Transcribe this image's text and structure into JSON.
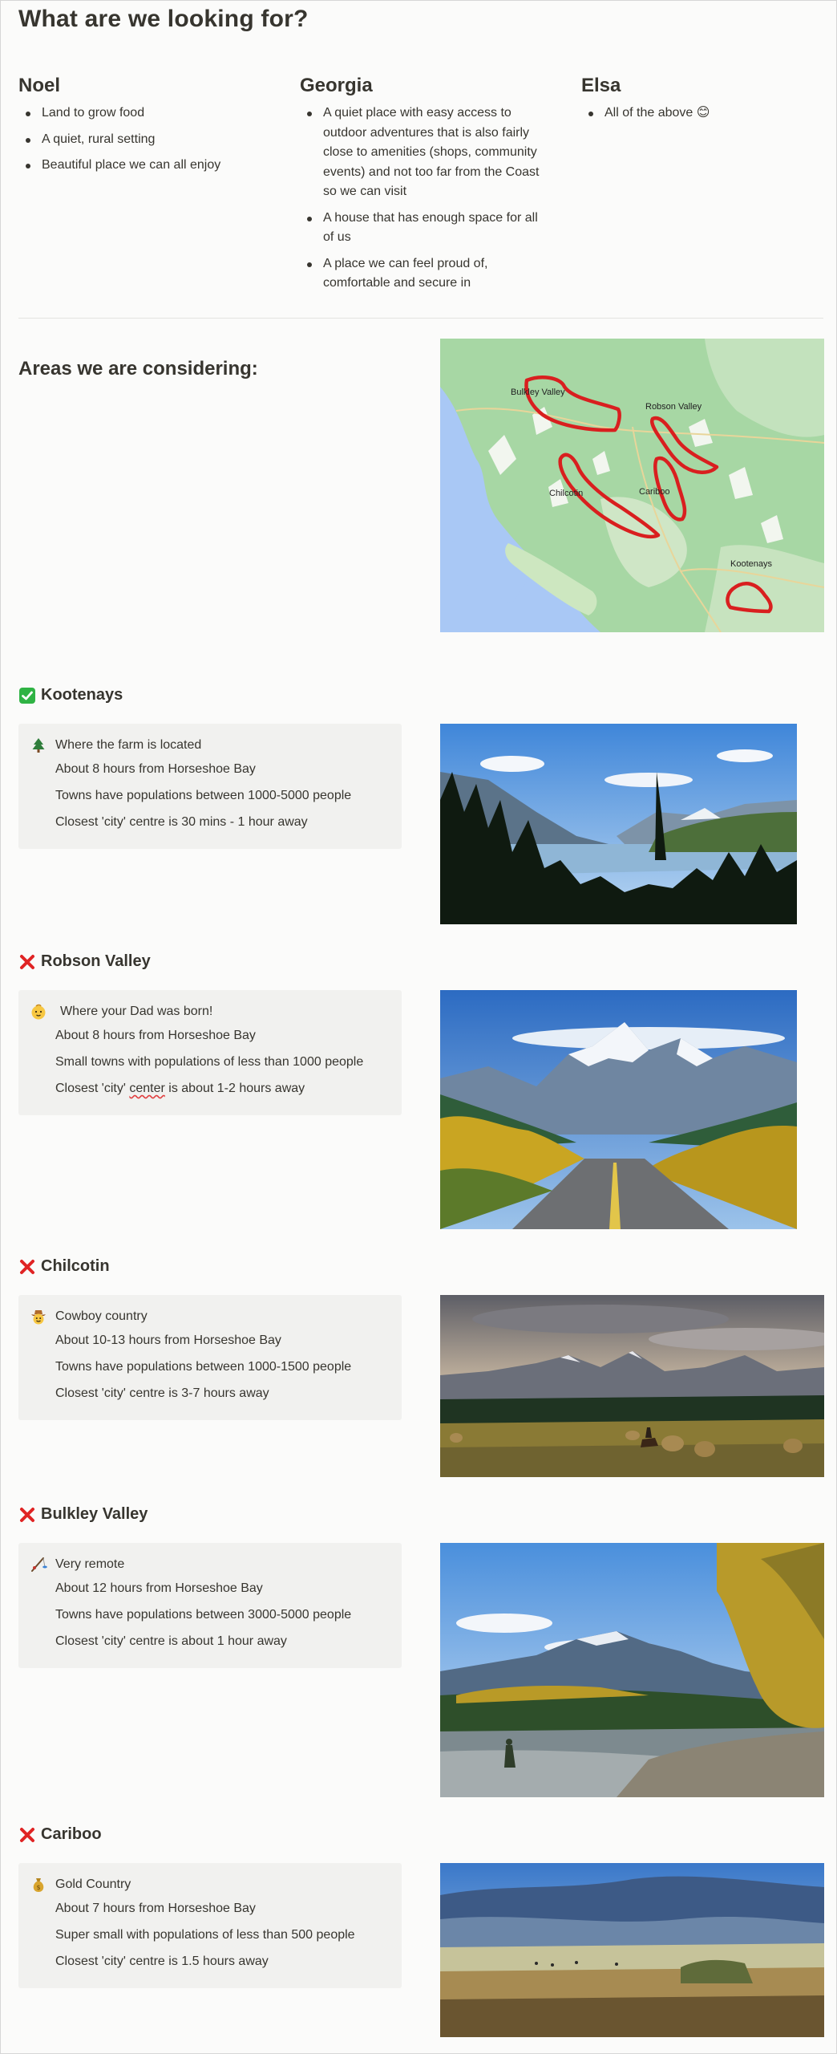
{
  "page": {
    "title": "What are we looking for?"
  },
  "people": [
    {
      "name": "Noel",
      "items": [
        "Land to grow food",
        "A quiet, rural setting",
        "Beautiful place we can all enjoy"
      ]
    },
    {
      "name": "Georgia",
      "items": [
        "A quiet place with easy access to outdoor adventures that is also fairly close to amenities (shops, community events) and not too far from the Coast so we can visit",
        "A house that has enough space for all of us",
        "A place we can feel proud of, comfortable and secure in"
      ]
    },
    {
      "name": "Elsa",
      "items": [
        "All of the above 😊"
      ]
    }
  ],
  "areas": {
    "title": "Areas we are considering:",
    "map_labels": [
      "Bulkley Valley",
      "Robson Valley",
      "Chilcotin",
      "Cariboo",
      "Kootenays"
    ]
  },
  "sections": [
    {
      "status": "check",
      "title": "Kootenays",
      "icon": "tree-icon",
      "lines": [
        "Where the farm is located",
        "About 8 hours from Horseshoe Bay",
        "Towns have populations between 1000-5000 people",
        "Closest 'city' centre is 30 mins - 1 hour away"
      ]
    },
    {
      "status": "cross",
      "title": "Robson Valley",
      "icon": "baby-face-icon",
      "lines": [
        "Where your Dad was born!",
        "About 8 hours from Horseshoe Bay",
        "Small towns with populations of less than 1000 people",
        "Closest 'city' center is about 1-2 hours away"
      ]
    },
    {
      "status": "cross",
      "title": "Chilcotin",
      "icon": "cowboy-face-icon",
      "lines": [
        "Cowboy country",
        "About 10-13 hours from Horseshoe Bay",
        "Towns have populations between 1000-1500 people",
        "Closest 'city' centre is 3-7 hours away"
      ]
    },
    {
      "status": "cross",
      "title": "Bulkley Valley",
      "icon": "fishing-rod-icon",
      "lines": [
        "Very remote",
        "About 12 hours from Horseshoe Bay",
        "Towns have populations between 3000-5000 people",
        "Closest 'city' centre is about 1 hour away"
      ]
    },
    {
      "status": "cross",
      "title": "Cariboo",
      "icon": "money-bag-icon",
      "lines": [
        "Gold Country",
        "About 7 hours from Horseshoe Bay",
        "Super small with populations of less than 500 people",
        "Closest 'city' centre is 1.5 hours away"
      ]
    }
  ],
  "colors": {
    "text": "#37352f",
    "callout_bg": "#f1f1ef",
    "check_green": "#2fb344",
    "cross_red": "#e02424",
    "map_line": "#d91f1f"
  }
}
